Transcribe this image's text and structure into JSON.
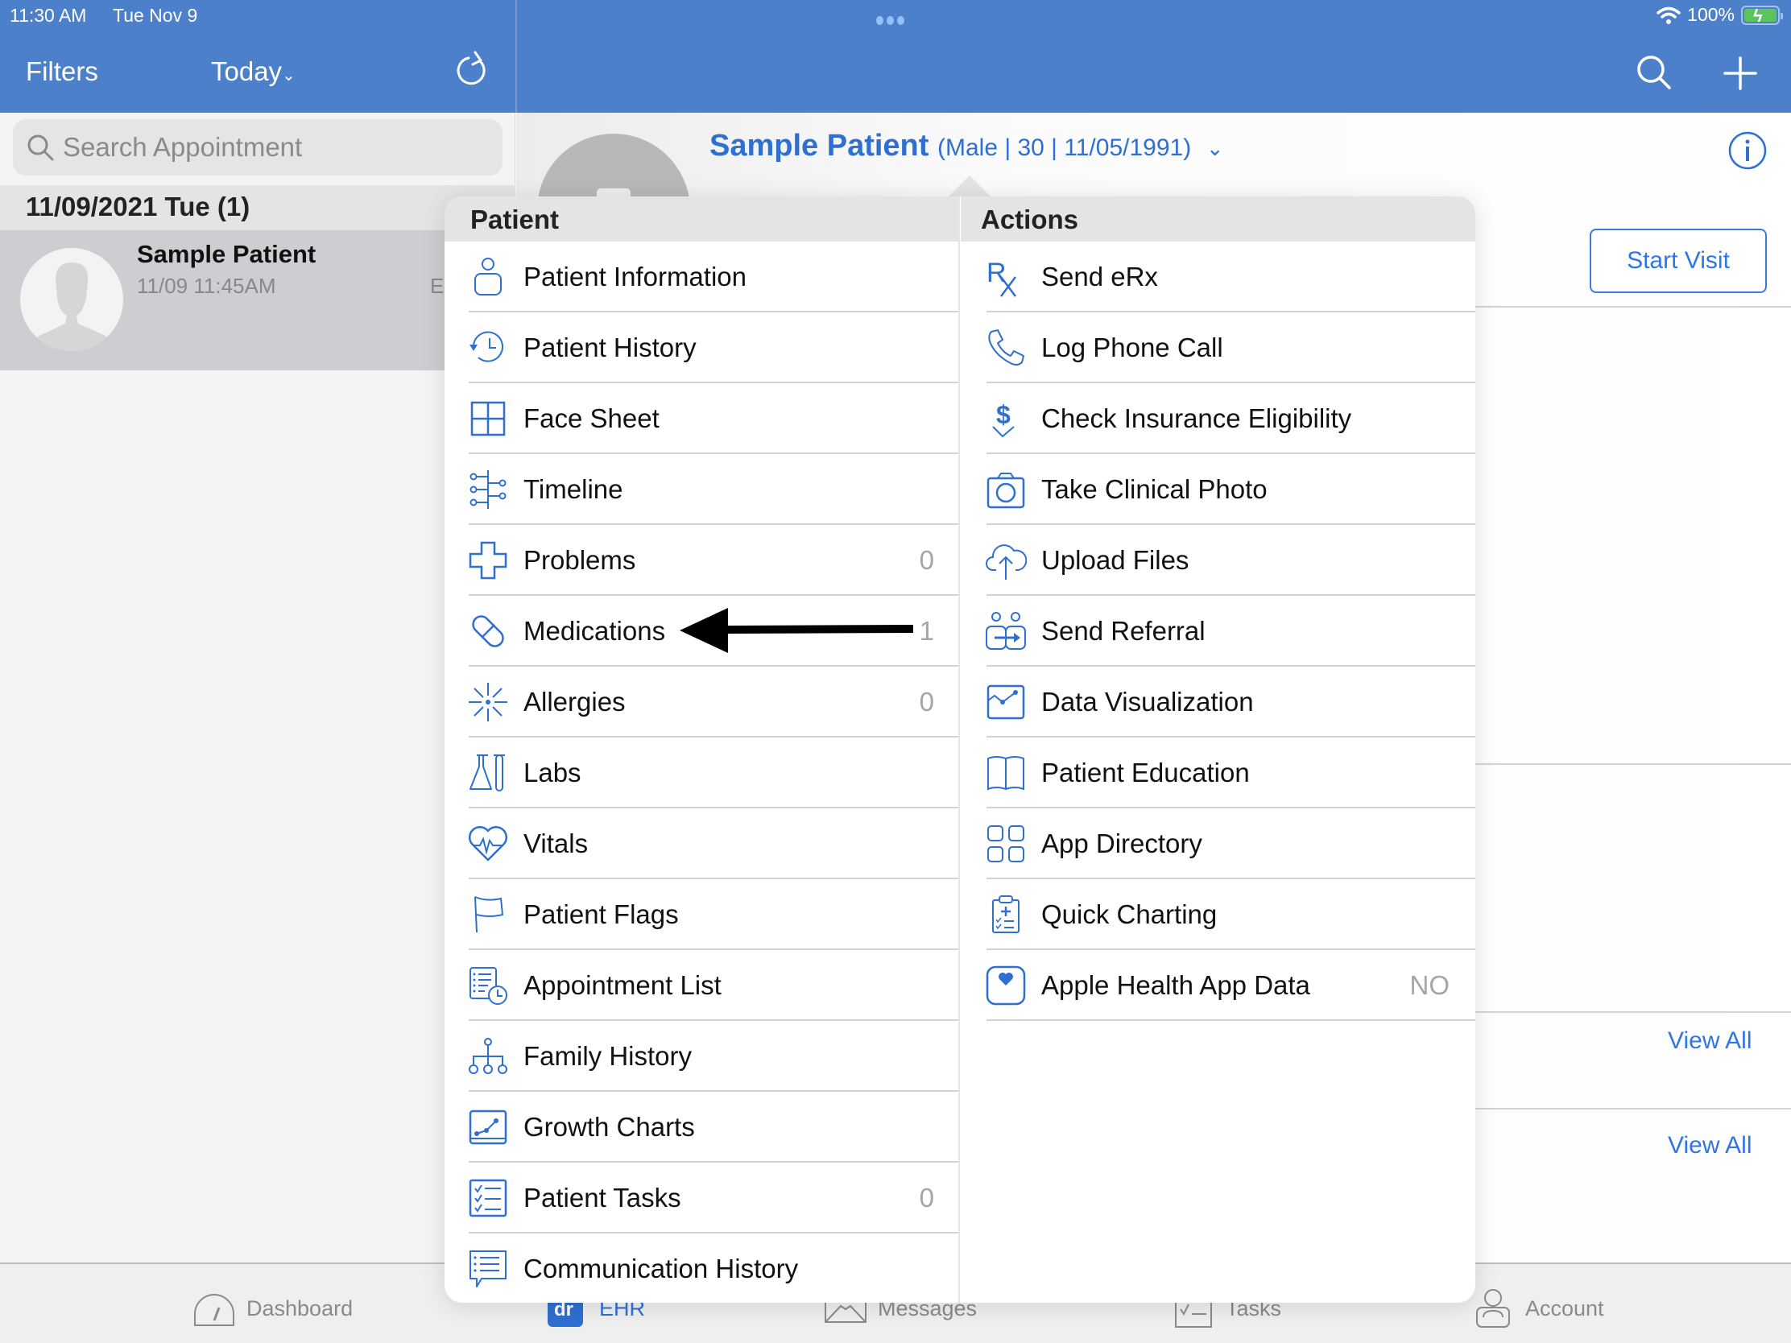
{
  "status_bar": {
    "time": "11:30 AM",
    "date": "Tue Nov 9",
    "battery": "100%",
    "colors": {
      "bar": "#4d80cb",
      "battery_fill": "#5cc45d"
    }
  },
  "nav": {
    "filters_label": "Filters",
    "today_label": "Today",
    "today_chevron": "⌄",
    "icons": [
      "refresh-icon",
      "search-icon",
      "plus-icon"
    ]
  },
  "sidebar": {
    "search_placeholder": "Search Appointment",
    "date_header": "11/09/2021 Tue (1)",
    "appointments": [
      {
        "name": "Sample Patient",
        "time": "11/09 11:45AM",
        "extra": "E"
      }
    ]
  },
  "patient_header": {
    "name": "Sample Patient",
    "meta": "(Male | 30 | 11/05/1991)",
    "chevron": "⌄",
    "start_visit_label": "Start Visit",
    "view_all_labels": [
      "View All",
      "View All"
    ],
    "accent": "#2f6fd0"
  },
  "popover": {
    "patient_header": "Patient",
    "actions_header": "Actions",
    "patient_items": [
      {
        "label": "Patient Information",
        "icon": "person-icon",
        "count": ""
      },
      {
        "label": "Patient History",
        "icon": "history-icon",
        "count": ""
      },
      {
        "label": "Face Sheet",
        "icon": "grid-icon",
        "count": ""
      },
      {
        "label": "Timeline",
        "icon": "timeline-icon",
        "count": ""
      },
      {
        "label": "Problems",
        "icon": "medical-cross-icon",
        "count": "0"
      },
      {
        "label": "Medications",
        "icon": "pill-icon",
        "count": "1"
      },
      {
        "label": "Allergies",
        "icon": "allergy-burst-icon",
        "count": "0"
      },
      {
        "label": "Labs",
        "icon": "lab-flask-icon",
        "count": ""
      },
      {
        "label": "Vitals",
        "icon": "heart-pulse-icon",
        "count": ""
      },
      {
        "label": "Patient Flags",
        "icon": "flag-icon",
        "count": ""
      },
      {
        "label": "Appointment List",
        "icon": "appointment-list-icon",
        "count": ""
      },
      {
        "label": "Family History",
        "icon": "family-tree-icon",
        "count": ""
      },
      {
        "label": "Growth Charts",
        "icon": "growth-chart-icon",
        "count": ""
      },
      {
        "label": "Patient Tasks",
        "icon": "checklist-icon",
        "count": "0"
      },
      {
        "label": "Communication History",
        "icon": "chat-list-icon",
        "count": ""
      }
    ],
    "action_items": [
      {
        "label": "Send eRx",
        "icon": "rx-icon",
        "value": ""
      },
      {
        "label": "Log Phone Call",
        "icon": "phone-icon",
        "value": ""
      },
      {
        "label": "Check Insurance Eligibility",
        "icon": "dollar-check-icon",
        "value": ""
      },
      {
        "label": "Take Clinical Photo",
        "icon": "camera-icon",
        "value": ""
      },
      {
        "label": "Upload Files",
        "icon": "cloud-upload-icon",
        "value": ""
      },
      {
        "label": "Send Referral",
        "icon": "referral-icon",
        "value": ""
      },
      {
        "label": "Data Visualization",
        "icon": "line-chart-icon",
        "value": ""
      },
      {
        "label": "Patient Education",
        "icon": "book-icon",
        "value": ""
      },
      {
        "label": "App Directory",
        "icon": "apps-grid-icon",
        "value": ""
      },
      {
        "label": "Quick Charting",
        "icon": "clipboard-icon",
        "value": ""
      },
      {
        "label": "Apple Health App Data",
        "icon": "health-heart-icon",
        "value": "NO"
      }
    ]
  },
  "annotation": {
    "points_to": "Medications"
  },
  "tabbar": {
    "tabs": [
      {
        "label": "Dashboard",
        "icon": "gauge-icon",
        "active": false
      },
      {
        "label": "EHR",
        "icon": "ehr-icon",
        "active": true
      },
      {
        "label": "Messages",
        "icon": "envelope-icon",
        "active": false
      },
      {
        "label": "Tasks",
        "icon": "tasks-icon",
        "active": false
      },
      {
        "label": "Account",
        "icon": "account-icon",
        "active": false
      }
    ]
  }
}
